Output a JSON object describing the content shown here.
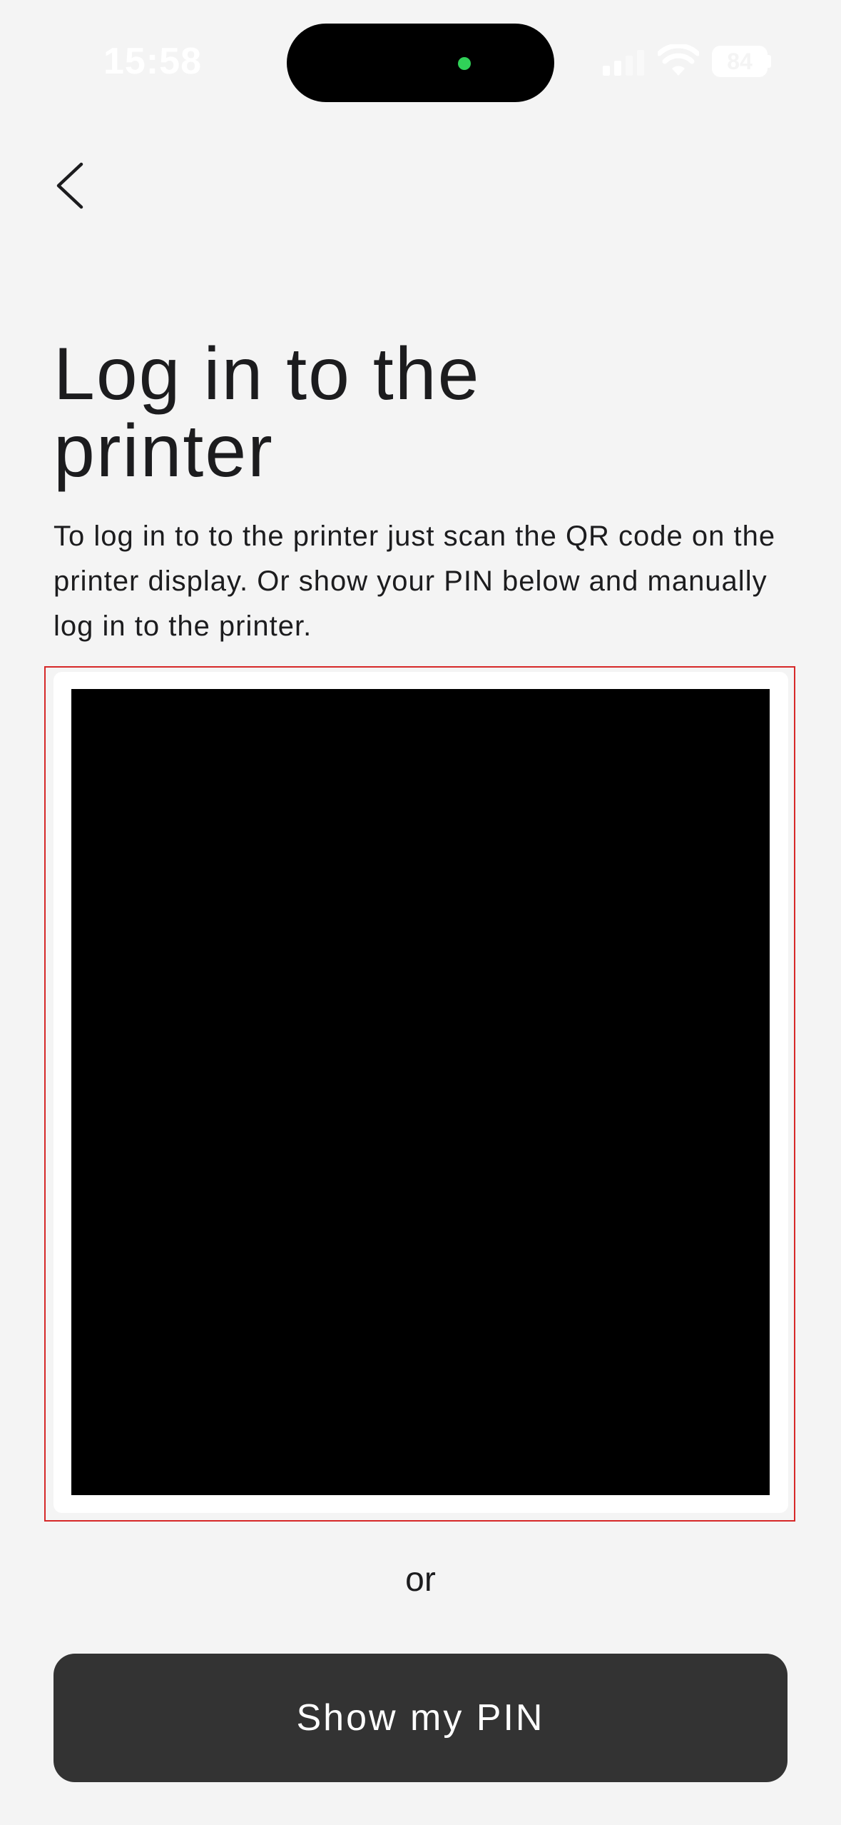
{
  "status_bar": {
    "time": "15:58",
    "battery": "84",
    "icons": [
      "signal-icon",
      "wifi-icon",
      "battery-icon"
    ]
  },
  "nav": {
    "back_icon": "chevron-left-icon"
  },
  "page": {
    "title_line1": "Log in to the",
    "title_line2": "printer",
    "description": "To log in to to the printer just scan the QR code on the printer display. Or show your PIN below and manually log in to the printer."
  },
  "qr": {
    "icon": "qr-code-image"
  },
  "divider_text": "or",
  "actions": {
    "show_pin_label": "Show my PIN"
  },
  "colors": {
    "background": "#f4f4f4",
    "button": "#333333",
    "highlight_frame": "#d62828"
  }
}
